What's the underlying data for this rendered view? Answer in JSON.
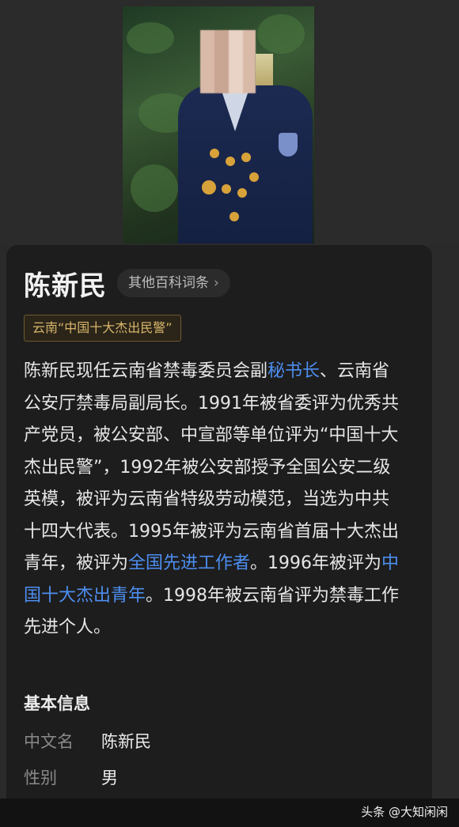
{
  "entry": {
    "name": "陈新民",
    "other_entries_label": "其他百科词条",
    "tag": "云南“中国十大杰出民警”"
  },
  "description": {
    "part1": "陈新民现任云南省禁毒委员会副",
    "link1": "秘书长",
    "part2": "、云南省公安厅禁毒局副局长。1991年被省委评为优秀共产党员，被公安部、中宣部等单位评为“中国十大杰出民警”，1992年被公安部授予全国公安二级英模，被评为云南省特级劳动模范，当选为中共十四大代表。1995年被评为云南省首届十大杰出青年，被评为",
    "link2": "全国先进工作者",
    "part3": "。1996年被评为",
    "link3": "中国十大杰出青年",
    "part4": "。1998年被云南省评为禁毒工作先进个人。"
  },
  "basic_info": {
    "heading": "基本信息",
    "rows": [
      {
        "key": "中文名",
        "value": "陈新民"
      },
      {
        "key": "性别",
        "value": "男"
      }
    ]
  },
  "watermark": "头条 @大知闲闲",
  "colors": {
    "link": "#4d8ef0",
    "tag_text": "#d7b66b",
    "background": "#1d1d1d"
  }
}
